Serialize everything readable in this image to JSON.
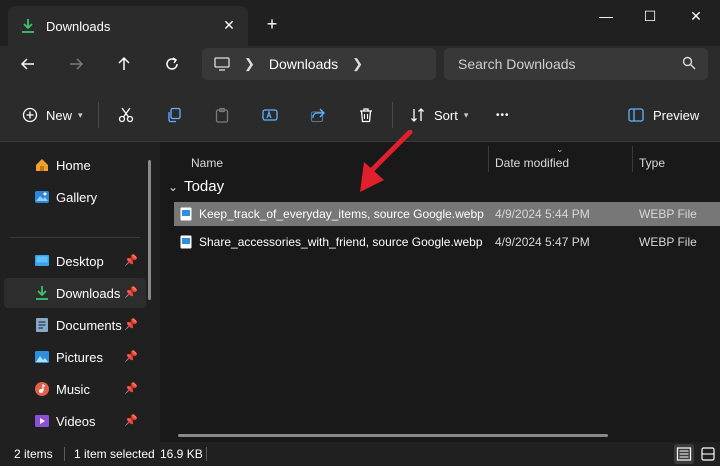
{
  "window": {
    "tab_title": "Downloads",
    "tab_close": "✕",
    "new_tab": "+",
    "minimize": "—",
    "maximize": "☐",
    "close": "✕"
  },
  "nav": {
    "breadcrumb": "Downloads",
    "search_placeholder": "Search Downloads"
  },
  "commands": {
    "new_label": "New",
    "sort_label": "Sort",
    "more_label": "•••",
    "preview_label": "Preview"
  },
  "sidebar": {
    "items": [
      {
        "label": "Home",
        "icon": "home-icon"
      },
      {
        "label": "Gallery",
        "icon": "gallery-icon"
      },
      {
        "label": "Desktop",
        "icon": "desktop-icon",
        "pinned": true
      },
      {
        "label": "Downloads",
        "icon": "downloads-icon",
        "pinned": true,
        "selected": true
      },
      {
        "label": "Documents",
        "icon": "documents-icon",
        "pinned": true
      },
      {
        "label": "Pictures",
        "icon": "pictures-icon",
        "pinned": true
      },
      {
        "label": "Music",
        "icon": "music-icon",
        "pinned": true
      },
      {
        "label": "Videos",
        "icon": "videos-icon",
        "pinned": true
      }
    ]
  },
  "columns": {
    "name": "Name",
    "date": "Date modified",
    "type": "Type"
  },
  "group": {
    "label": "Today"
  },
  "files": [
    {
      "name": "Keep_track_of_everyday_items, source Google.webp",
      "date": "4/9/2024 5:44 PM",
      "type": "WEBP File",
      "selected": true
    },
    {
      "name": "Share_accessories_with_friend, source Google.webp",
      "date": "4/9/2024 5:47 PM",
      "type": "WEBP File",
      "selected": false
    }
  ],
  "status": {
    "count": "2 items",
    "selection": "1 item selected",
    "size": "16.9 KB"
  },
  "colors": {
    "accent": "#2ea3ff",
    "download_green": "#3ec46d",
    "annotation_red": "#e0202a",
    "selected_row": "#777777"
  }
}
